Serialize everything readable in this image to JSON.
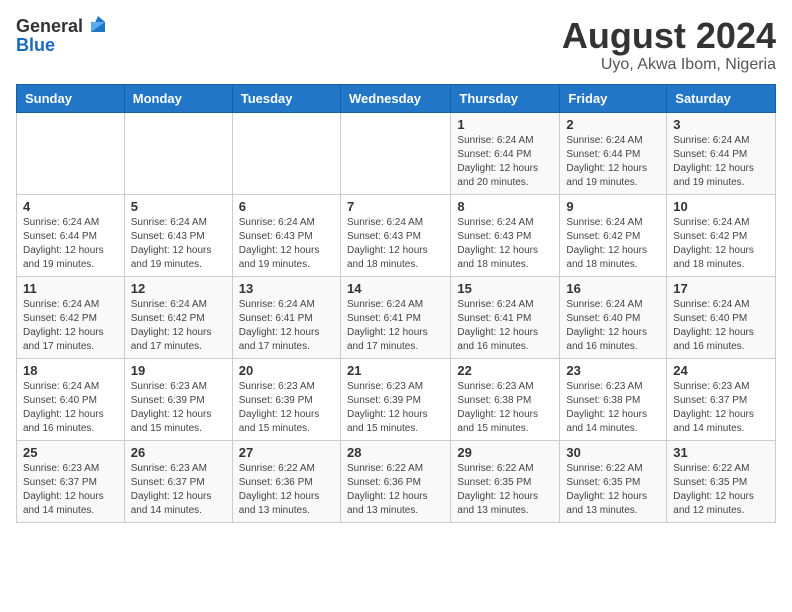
{
  "header": {
    "logo_general": "General",
    "logo_blue": "Blue",
    "month_title": "August 2024",
    "location": "Uyo, Akwa Ibom, Nigeria"
  },
  "days_of_week": [
    "Sunday",
    "Monday",
    "Tuesday",
    "Wednesday",
    "Thursday",
    "Friday",
    "Saturday"
  ],
  "weeks": [
    [
      {
        "day": "",
        "info": ""
      },
      {
        "day": "",
        "info": ""
      },
      {
        "day": "",
        "info": ""
      },
      {
        "day": "",
        "info": ""
      },
      {
        "day": "1",
        "info": "Sunrise: 6:24 AM\nSunset: 6:44 PM\nDaylight: 12 hours\nand 20 minutes."
      },
      {
        "day": "2",
        "info": "Sunrise: 6:24 AM\nSunset: 6:44 PM\nDaylight: 12 hours\nand 19 minutes."
      },
      {
        "day": "3",
        "info": "Sunrise: 6:24 AM\nSunset: 6:44 PM\nDaylight: 12 hours\nand 19 minutes."
      }
    ],
    [
      {
        "day": "4",
        "info": "Sunrise: 6:24 AM\nSunset: 6:44 PM\nDaylight: 12 hours\nand 19 minutes."
      },
      {
        "day": "5",
        "info": "Sunrise: 6:24 AM\nSunset: 6:43 PM\nDaylight: 12 hours\nand 19 minutes."
      },
      {
        "day": "6",
        "info": "Sunrise: 6:24 AM\nSunset: 6:43 PM\nDaylight: 12 hours\nand 19 minutes."
      },
      {
        "day": "7",
        "info": "Sunrise: 6:24 AM\nSunset: 6:43 PM\nDaylight: 12 hours\nand 18 minutes."
      },
      {
        "day": "8",
        "info": "Sunrise: 6:24 AM\nSunset: 6:43 PM\nDaylight: 12 hours\nand 18 minutes."
      },
      {
        "day": "9",
        "info": "Sunrise: 6:24 AM\nSunset: 6:42 PM\nDaylight: 12 hours\nand 18 minutes."
      },
      {
        "day": "10",
        "info": "Sunrise: 6:24 AM\nSunset: 6:42 PM\nDaylight: 12 hours\nand 18 minutes."
      }
    ],
    [
      {
        "day": "11",
        "info": "Sunrise: 6:24 AM\nSunset: 6:42 PM\nDaylight: 12 hours\nand 17 minutes."
      },
      {
        "day": "12",
        "info": "Sunrise: 6:24 AM\nSunset: 6:42 PM\nDaylight: 12 hours\nand 17 minutes."
      },
      {
        "day": "13",
        "info": "Sunrise: 6:24 AM\nSunset: 6:41 PM\nDaylight: 12 hours\nand 17 minutes."
      },
      {
        "day": "14",
        "info": "Sunrise: 6:24 AM\nSunset: 6:41 PM\nDaylight: 12 hours\nand 17 minutes."
      },
      {
        "day": "15",
        "info": "Sunrise: 6:24 AM\nSunset: 6:41 PM\nDaylight: 12 hours\nand 16 minutes."
      },
      {
        "day": "16",
        "info": "Sunrise: 6:24 AM\nSunset: 6:40 PM\nDaylight: 12 hours\nand 16 minutes."
      },
      {
        "day": "17",
        "info": "Sunrise: 6:24 AM\nSunset: 6:40 PM\nDaylight: 12 hours\nand 16 minutes."
      }
    ],
    [
      {
        "day": "18",
        "info": "Sunrise: 6:24 AM\nSunset: 6:40 PM\nDaylight: 12 hours\nand 16 minutes."
      },
      {
        "day": "19",
        "info": "Sunrise: 6:23 AM\nSunset: 6:39 PM\nDaylight: 12 hours\nand 15 minutes."
      },
      {
        "day": "20",
        "info": "Sunrise: 6:23 AM\nSunset: 6:39 PM\nDaylight: 12 hours\nand 15 minutes."
      },
      {
        "day": "21",
        "info": "Sunrise: 6:23 AM\nSunset: 6:39 PM\nDaylight: 12 hours\nand 15 minutes."
      },
      {
        "day": "22",
        "info": "Sunrise: 6:23 AM\nSunset: 6:38 PM\nDaylight: 12 hours\nand 15 minutes."
      },
      {
        "day": "23",
        "info": "Sunrise: 6:23 AM\nSunset: 6:38 PM\nDaylight: 12 hours\nand 14 minutes."
      },
      {
        "day": "24",
        "info": "Sunrise: 6:23 AM\nSunset: 6:37 PM\nDaylight: 12 hours\nand 14 minutes."
      }
    ],
    [
      {
        "day": "25",
        "info": "Sunrise: 6:23 AM\nSunset: 6:37 PM\nDaylight: 12 hours\nand 14 minutes."
      },
      {
        "day": "26",
        "info": "Sunrise: 6:23 AM\nSunset: 6:37 PM\nDaylight: 12 hours\nand 14 minutes."
      },
      {
        "day": "27",
        "info": "Sunrise: 6:22 AM\nSunset: 6:36 PM\nDaylight: 12 hours\nand 13 minutes."
      },
      {
        "day": "28",
        "info": "Sunrise: 6:22 AM\nSunset: 6:36 PM\nDaylight: 12 hours\nand 13 minutes."
      },
      {
        "day": "29",
        "info": "Sunrise: 6:22 AM\nSunset: 6:35 PM\nDaylight: 12 hours\nand 13 minutes."
      },
      {
        "day": "30",
        "info": "Sunrise: 6:22 AM\nSunset: 6:35 PM\nDaylight: 12 hours\nand 13 minutes."
      },
      {
        "day": "31",
        "info": "Sunrise: 6:22 AM\nSunset: 6:35 PM\nDaylight: 12 hours\nand 12 minutes."
      }
    ]
  ]
}
